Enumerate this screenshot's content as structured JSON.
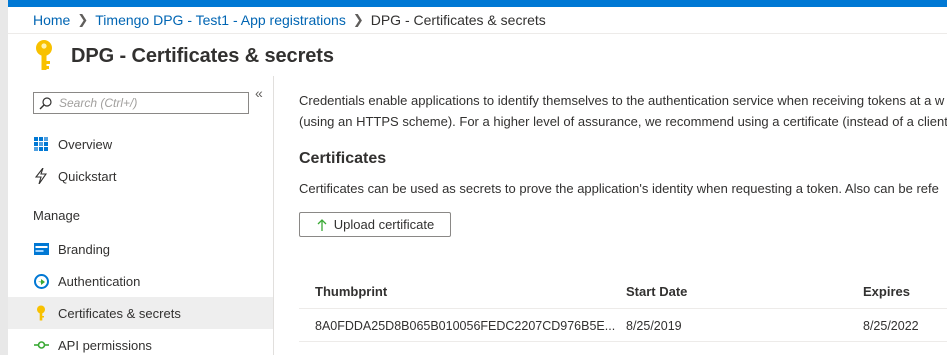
{
  "breadcrumb": {
    "items": [
      "Home",
      "Timengo DPG - Test1 - App registrations"
    ],
    "current": "DPG - Certificates & secrets"
  },
  "page": {
    "title": "DPG - Certificates & secrets"
  },
  "sidebar": {
    "search_placeholder": "Search (Ctrl+/)",
    "collapse_symbol": "«",
    "items_top": [
      {
        "label": "Overview",
        "icon": "overview-grid-icon"
      },
      {
        "label": "Quickstart",
        "icon": "quickstart-bolt-icon"
      }
    ],
    "group_label": "Manage",
    "items_manage": [
      {
        "label": "Branding",
        "icon": "branding-icon"
      },
      {
        "label": "Authentication",
        "icon": "authentication-icon"
      },
      {
        "label": "Certificates & secrets",
        "icon": "key-icon",
        "active": true
      },
      {
        "label": "API permissions",
        "icon": "api-permissions-icon"
      }
    ]
  },
  "main": {
    "description_line1": "Credentials enable applications to identify themselves to the authentication service when receiving tokens at a w",
    "description_line2": "(using an HTTPS scheme). For a higher level of assurance, we recommend using a certificate (instead of a client",
    "certificates": {
      "title": "Certificates",
      "description": "Certificates can be used as secrets to prove the application's identity when requesting a token. Also can be refe",
      "upload_label": "Upload certificate",
      "columns": [
        "Thumbprint",
        "Start Date",
        "Expires"
      ],
      "rows": [
        [
          "8A0FDDA25D8B065B010056FEDC2207CD976B5E...",
          "8/25/2019",
          "8/25/2022"
        ]
      ]
    }
  },
  "colors": {
    "accent": "#0078d4",
    "link": "#0065b3",
    "key": "#f8c100",
    "active_bg": "#eeeeee"
  }
}
